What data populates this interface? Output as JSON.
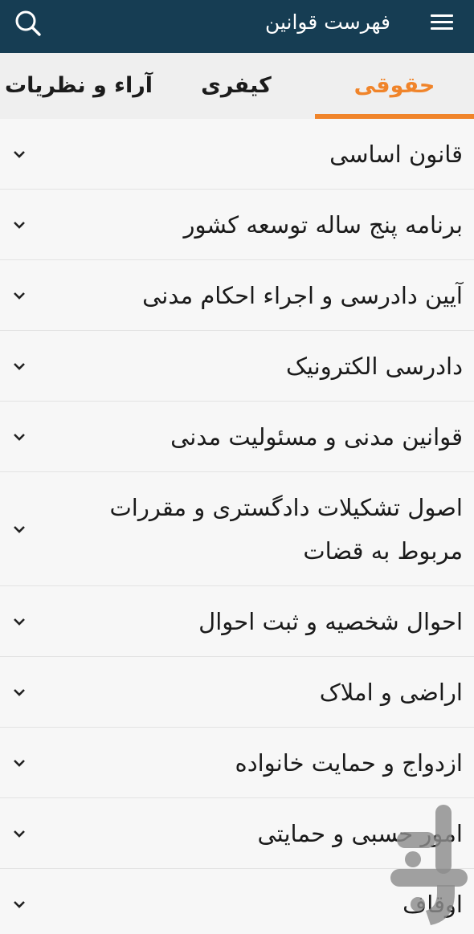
{
  "appbar": {
    "title": "فهرست قوانین",
    "menu_icon": "menu-icon",
    "search_icon": "search-icon",
    "bg_color": "#163d53"
  },
  "tabs": [
    {
      "label": "حقوقی",
      "active": true
    },
    {
      "label": "کیفری",
      "active": false
    },
    {
      "label": "آراء و نظریات",
      "active": false
    }
  ],
  "accent_color": "#f0842a",
  "categories": [
    {
      "label": "قانون اساسی"
    },
    {
      "label": "برنامه پنج ساله توسعه کشور"
    },
    {
      "label": "آیین دادرسی و اجراء احکام مدنی"
    },
    {
      "label": "دادرسی الکترونیک"
    },
    {
      "label": "قوانین مدنی و مسئولیت مدنی"
    },
    {
      "label": "اصول تشکیلات دادگستری و مقررات مربوط به قضات"
    },
    {
      "label": "احوال شخصیه و ثبت احوال"
    },
    {
      "label": "اراضی و املاک"
    },
    {
      "label": "ازدواج و حمایت خانواده"
    },
    {
      "label": "امور حسبی و حمایتی"
    },
    {
      "label": "اوقاف"
    }
  ],
  "row_icon": "chevron-down-icon",
  "watermark_icon": "app-logo-icon"
}
